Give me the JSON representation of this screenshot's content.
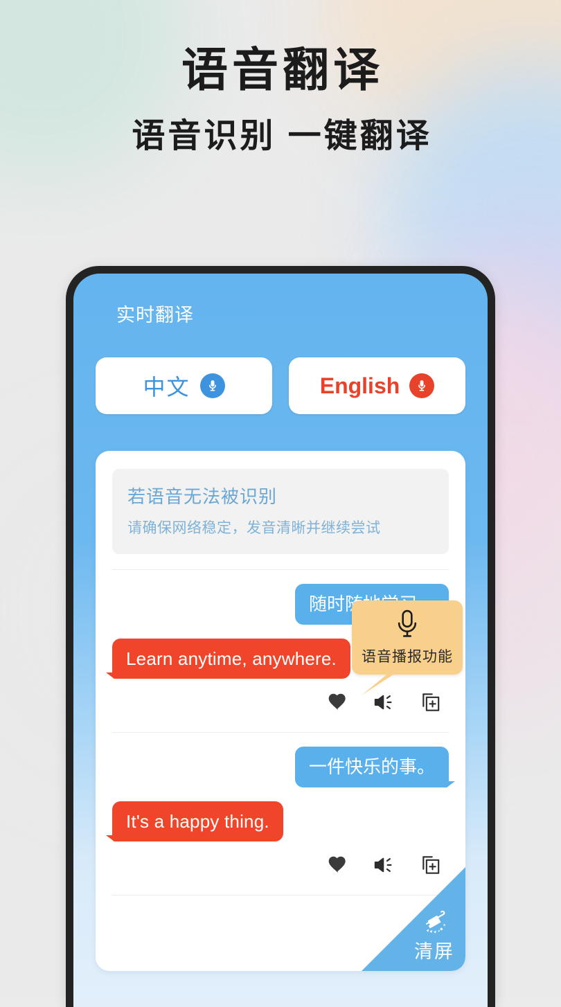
{
  "poster": {
    "headline": "语音翻译",
    "subheadline": "语音识别 一键翻译",
    "bg_colors": {
      "base": "#eaeaea",
      "mint": "#cfe6de",
      "peach": "#f3e2cf",
      "blue": "#bfdcf5",
      "lilac": "#d9d3f0",
      "pink": "#f3d9e6"
    }
  },
  "app": {
    "title": "实时翻译",
    "header_color": "#64b4ef",
    "language_buttons": [
      {
        "label": "中文",
        "icon": "microphone-icon",
        "color": "#3d93dd"
      },
      {
        "label": "English",
        "icon": "microphone-icon",
        "color": "#e8432a"
      }
    ],
    "notice": {
      "title": "若语音无法被识别",
      "subtitle": "请确保网络稳定，发音清晰并继续尝试",
      "title_color": "#6aa7d4",
      "subtitle_color": "#7fb2d8"
    },
    "conversations": [
      {
        "source": {
          "text": "随时随地学习。",
          "lang": "zh",
          "color": "#59b0eb"
        },
        "target": {
          "text": "Learn anytime, anywhere.",
          "lang": "en",
          "color": "#f0452a"
        },
        "actions": [
          {
            "name": "favorite-icon",
            "label": "收藏"
          },
          {
            "name": "speaker-icon",
            "label": "播报"
          },
          {
            "name": "copy-add-icon",
            "label": "添加"
          }
        ]
      },
      {
        "source": {
          "text": "一件快乐的事。",
          "lang": "zh",
          "color": "#59b0eb"
        },
        "target": {
          "text": "It's a happy thing.",
          "lang": "en",
          "color": "#f0452a"
        },
        "actions": [
          {
            "name": "favorite-icon",
            "label": "收藏"
          },
          {
            "name": "speaker-icon",
            "label": "播报"
          },
          {
            "name": "copy-add-icon",
            "label": "添加"
          }
        ]
      }
    ],
    "tooltip": {
      "text": "语音播报功能",
      "icon": "microphone-icon",
      "background": "#f8cf8b"
    },
    "clear_button": {
      "label": "清屏",
      "icon": "broom-icon",
      "color": "#63b2e8"
    }
  }
}
